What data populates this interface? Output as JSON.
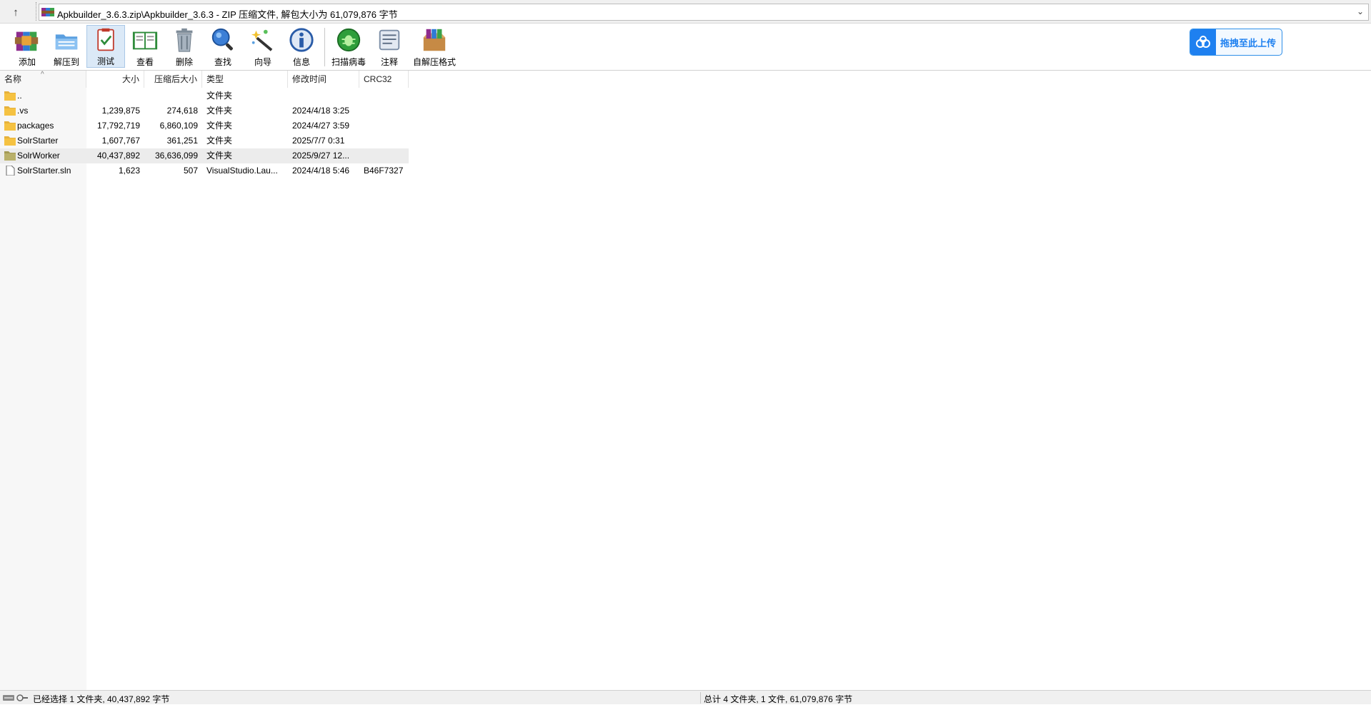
{
  "window": {
    "address": "Apkbuilder_3.6.3.zip\\Apkbuilder_3.6.3 - ZIP 压缩文件, 解包大小为 61,079,876 字节"
  },
  "toolbar": {
    "buttons": [
      {
        "label": "添加",
        "icon": "add-archive-icon"
      },
      {
        "label": "解压到",
        "icon": "extract-to-icon"
      },
      {
        "label": "测试",
        "icon": "test-icon"
      },
      {
        "label": "查看",
        "icon": "view-icon"
      },
      {
        "label": "删除",
        "icon": "delete-icon"
      },
      {
        "label": "查找",
        "icon": "find-icon"
      },
      {
        "label": "向导",
        "icon": "wizard-icon"
      },
      {
        "label": "信息",
        "icon": "info-icon"
      },
      {
        "label": "扫描病毒",
        "icon": "scan-virus-icon"
      },
      {
        "label": "注释",
        "icon": "comment-icon"
      },
      {
        "label": "自解压格式",
        "icon": "sfx-icon"
      }
    ],
    "active_index": 2,
    "cloud_label": "拖拽至此上传"
  },
  "columns": [
    "名称",
    "大小",
    "压缩后大小",
    "类型",
    "修改时间",
    "CRC32"
  ],
  "files": [
    {
      "name": "..",
      "size": "",
      "packed": "",
      "type": "文件夹",
      "modified": "",
      "crc": "",
      "kind": "folder"
    },
    {
      "name": ".vs",
      "size": "1,239,875",
      "packed": "274,618",
      "type": "文件夹",
      "modified": "2024/4/18 3:25",
      "crc": "",
      "kind": "folder"
    },
    {
      "name": "packages",
      "size": "17,792,719",
      "packed": "6,860,109",
      "type": "文件夹",
      "modified": "2024/4/27 3:59",
      "crc": "",
      "kind": "folder"
    },
    {
      "name": "SolrStarter",
      "size": "1,607,767",
      "packed": "361,251",
      "type": "文件夹",
      "modified": "2025/7/7 0:31",
      "crc": "",
      "kind": "folder"
    },
    {
      "name": "SolrWorker",
      "size": "40,437,892",
      "packed": "36,636,099",
      "type": "文件夹",
      "modified": "2025/9/27 12...",
      "crc": "",
      "kind": "folder",
      "selected": true
    },
    {
      "name": "SolrStarter.sln",
      "size": "1,623",
      "packed": "507",
      "type": "VisualStudio.Lau...",
      "modified": "2024/4/18 5:46",
      "crc": "B46F7327",
      "kind": "file"
    }
  ],
  "status": {
    "left": "已经选择 1 文件夹, 40,437,892 字节",
    "right": "总计 4 文件夹, 1 文件, 61,079,876 字节"
  },
  "colors": {
    "accent": "#1e80f0",
    "selected_row": "#ececec",
    "folder": "#f5c242"
  }
}
